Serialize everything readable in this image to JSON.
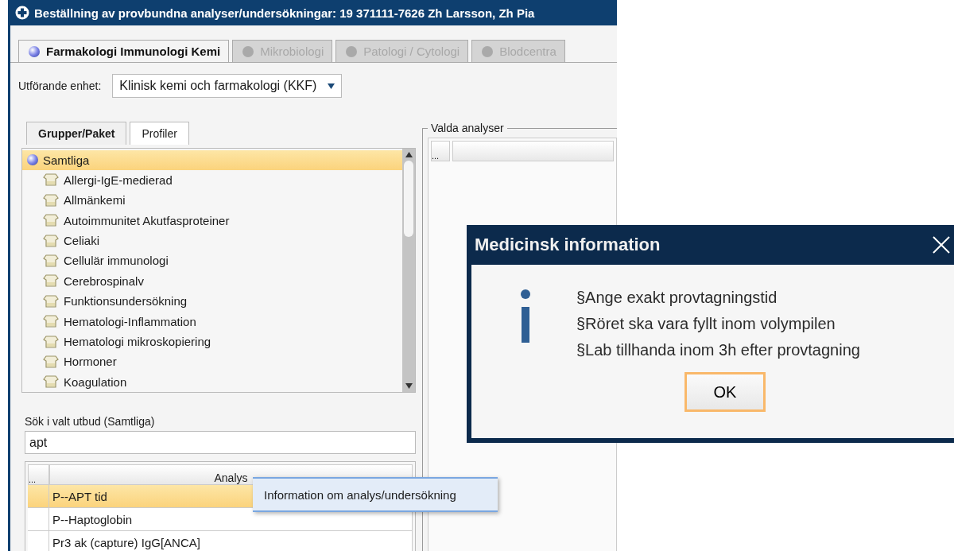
{
  "window": {
    "title": "Beställning av provbundna analyser/undersökningar: 19 371111-7626 Zh Larsson, Zh Pia"
  },
  "tabs": [
    {
      "label": "Farmakologi Immunologi Kemi",
      "selected": true,
      "disabled": false
    },
    {
      "label": "Mikrobiologi",
      "selected": false,
      "disabled": true
    },
    {
      "label": "Patologi / Cytologi",
      "selected": false,
      "disabled": true
    },
    {
      "label": "Blodcentra",
      "selected": false,
      "disabled": true
    }
  ],
  "unit": {
    "label": "Utförande enhet:",
    "value": "Klinisk kemi och farmakologi (KKF)"
  },
  "group_tabs": [
    {
      "label": "Grupper/Paket",
      "selected": true
    },
    {
      "label": "Profiler",
      "selected": false
    }
  ],
  "group_tree": {
    "label": "Samtliga",
    "selected": true,
    "children": [
      {
        "label": "Allergi-IgE-medierad",
        "selected": false
      },
      {
        "label": "Allmänkemi",
        "selected": false
      },
      {
        "label": "Autoimmunitet Akutfasproteiner",
        "selected": false
      },
      {
        "label": "Celiaki",
        "selected": false
      },
      {
        "label": "Cellulär immunologi",
        "selected": false
      },
      {
        "label": "Cerebrospinalv",
        "selected": false
      },
      {
        "label": "Funktionsundersökning",
        "selected": false
      },
      {
        "label": "Hematologi-Inflammation",
        "selected": false
      },
      {
        "label": "Hematologi mikroskopiering",
        "selected": false
      },
      {
        "label": "Hormoner",
        "selected": false
      },
      {
        "label": "Koagulation",
        "selected": false
      }
    ]
  },
  "search": {
    "label": "Sök i valt utbud (Samtliga)",
    "value": "apt"
  },
  "results": {
    "columns": [
      "...",
      "Analys"
    ],
    "rows": [
      {
        "analysis": "P--APT tid",
        "selected": true
      },
      {
        "analysis": "P--Haptoglobin",
        "selected": false
      },
      {
        "analysis": "Pr3 ak (capture) IgG[ANCA]",
        "selected": false
      }
    ]
  },
  "selected_analyses": {
    "title": "Valda analyser",
    "columns": [
      "..."
    ]
  },
  "context_menu": {
    "items": [
      "Information om analys/undersökning"
    ]
  },
  "dialog": {
    "title": "Medicinsk information",
    "lines": [
      "§Ange exakt provtagningstid",
      "§Röret ska vara fyllt inom volympilen",
      "§Lab tillhanda inom 3h efter provtagning"
    ],
    "buttons": [
      "OK"
    ]
  }
}
